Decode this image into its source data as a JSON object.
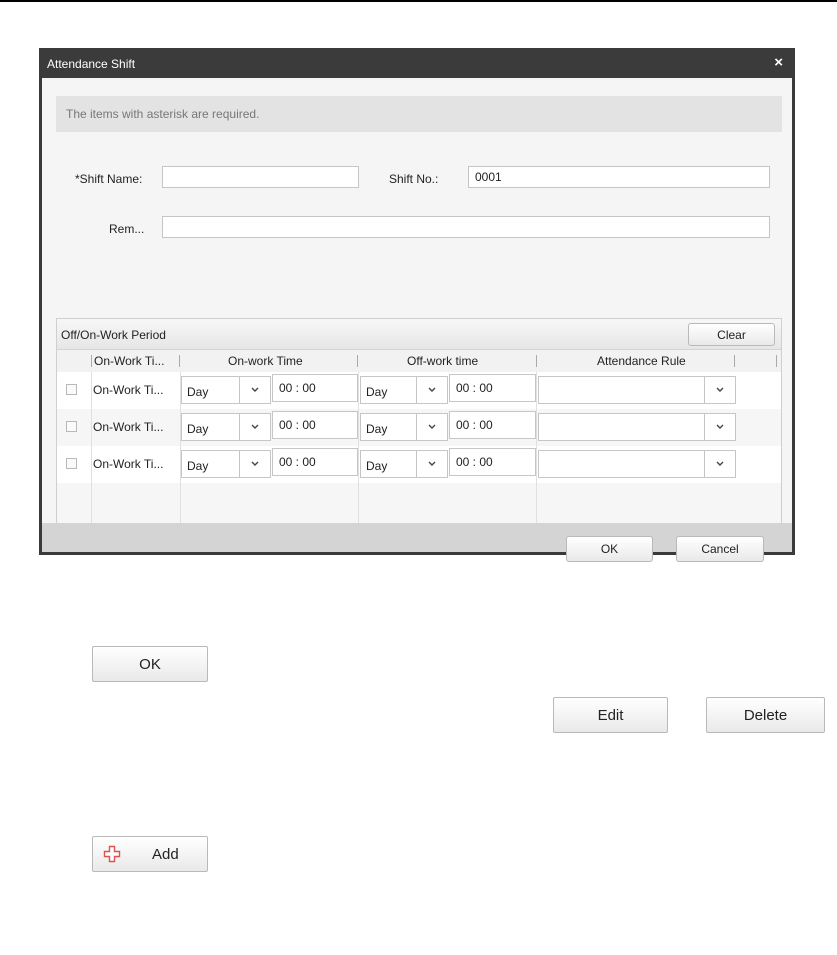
{
  "dialog": {
    "title": "Attendance Shift",
    "close_symbol": "×",
    "notice": "The items with asterisk are required.",
    "shift_name_label": "*Shift Name:",
    "shift_name_value": "",
    "shift_no_label": "Shift No.:",
    "shift_no_value": "0001",
    "remark_label": "Rem...",
    "remark_value": "",
    "period": {
      "title": "Off/On-Work Period",
      "clear_label": "Clear",
      "columns": [
        "On-Work Ti...",
        "On-work Time",
        "Off-work time",
        "Attendance Rule"
      ],
      "rows": [
        {
          "name": "On-Work Ti...",
          "on_day": "Day",
          "on_time": "00 : 00",
          "off_day": "Day",
          "off_time": "00 : 00",
          "rule": ""
        },
        {
          "name": "On-Work Ti...",
          "on_day": "Day",
          "on_time": "00 : 00",
          "off_day": "Day",
          "off_time": "00 : 00",
          "rule": ""
        },
        {
          "name": "On-Work Ti...",
          "on_day": "Day",
          "on_time": "00 : 00",
          "off_day": "Day",
          "off_time": "00 : 00",
          "rule": ""
        }
      ]
    },
    "ok_label": "OK",
    "cancel_label": "Cancel"
  },
  "buttons": {
    "ok_label": "OK",
    "edit_label": "Edit",
    "delete_label": "Delete",
    "add_label": "Add"
  },
  "icons": {
    "close": "close-icon",
    "dropdown": "chevron-down-icon",
    "add": "plus-icon"
  },
  "colors": {
    "titlebar": "#3b3b3b",
    "add_icon": "#d9534f"
  }
}
